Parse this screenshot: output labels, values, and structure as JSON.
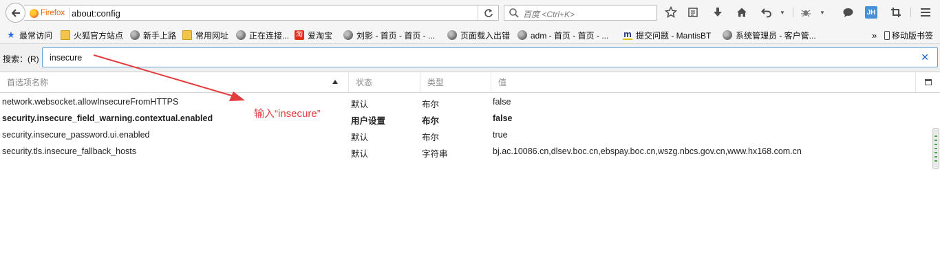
{
  "browser": {
    "identity_label": "Firefox",
    "url": "about:config",
    "search_placeholder": "百度 <Ctrl+K>",
    "profile_initials": "JH"
  },
  "bookmarks": [
    {
      "label": "最常访问",
      "icon": "star-icon"
    },
    {
      "label": "火狐官方站点",
      "icon": "folder-icon"
    },
    {
      "label": "新手上路",
      "icon": "globe-icon"
    },
    {
      "label": "常用网址",
      "icon": "folder-icon"
    },
    {
      "label": "正在连接...",
      "icon": "globe-icon"
    },
    {
      "label": "爱淘宝",
      "icon": "taobao-icon"
    },
    {
      "label": "刘影 - 首页 - 首页 - ...",
      "icon": "globe-icon"
    },
    {
      "label": "页面载入出错",
      "icon": "globe-icon"
    },
    {
      "label": "adm - 首页 - 首页 - ...",
      "icon": "globe-icon"
    },
    {
      "label": "提交问题 - MantisBT",
      "icon": "mantis-icon"
    },
    {
      "label": "系统管理员 - 客户管...",
      "icon": "globe-icon"
    }
  ],
  "bookmarks_overflow": "»",
  "mobile_bookmarks": "移动版书签",
  "search_row": {
    "label": "搜索：(R)",
    "value": "insecure"
  },
  "columns": {
    "name": "首选项名称",
    "status": "状态",
    "type": "类型",
    "value": "值"
  },
  "rows": [
    {
      "name": "network.websocket.allowInsecureFromHTTPS",
      "status": "默认",
      "type": "布尔",
      "value": "false",
      "modified": false
    },
    {
      "name": "security.insecure_field_warning.contextual.enabled",
      "status": "用户设置",
      "type": "布尔",
      "value": "false",
      "modified": true
    },
    {
      "name": "security.insecure_password.ui.enabled",
      "status": "默认",
      "type": "布尔",
      "value": "true",
      "modified": false
    },
    {
      "name": "security.tls.insecure_fallback_hosts",
      "status": "默认",
      "type": "字符串",
      "value": "bj.ac.10086.cn,dlsev.boc.cn,ebspay.boc.cn,wszg.nbcs.gov.cn,www.hx168.com.cn",
      "modified": false
    }
  ],
  "annotation": {
    "text": "输入“insecure”",
    "color": "#e33b3b"
  },
  "colors": {
    "accent_focus": "#5ca1d6",
    "identity": "#e6660c"
  }
}
